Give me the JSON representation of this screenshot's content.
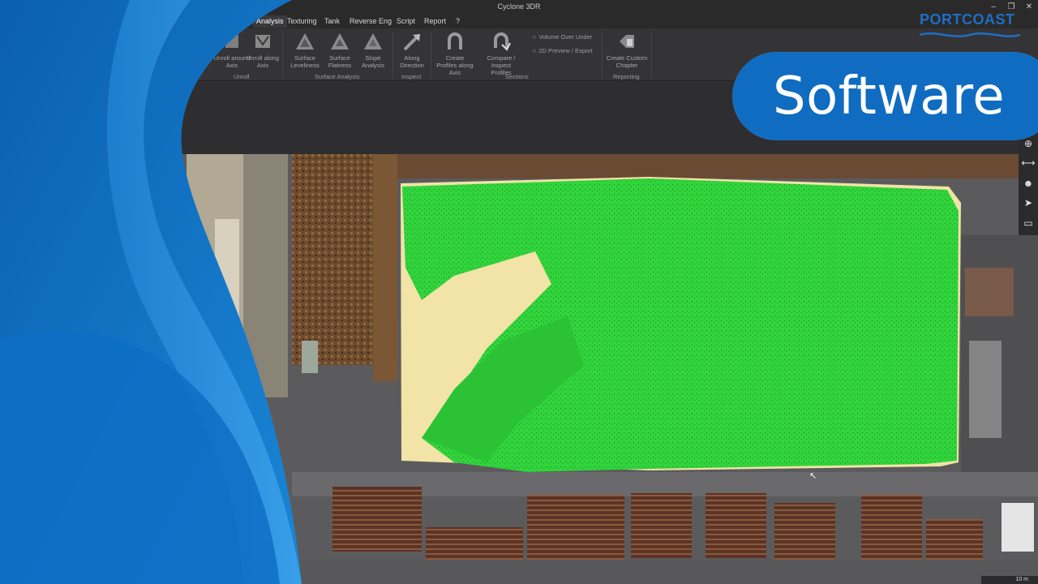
{
  "app": {
    "title": "Cyclone 3DR",
    "window_controls": [
      "–",
      "❐",
      "✕"
    ]
  },
  "menu": {
    "items": [
      {
        "label": "Analysis",
        "active": true
      },
      {
        "label": "Texturing"
      },
      {
        "label": "Tank"
      },
      {
        "label": "Reverse Eng"
      },
      {
        "label": "Script"
      },
      {
        "label": "Report"
      },
      {
        "label": "?"
      }
    ]
  },
  "ribbon": {
    "buttons": [
      {
        "label": "Unroll around Axis"
      },
      {
        "label": "Unroll along Axis"
      },
      {
        "label": "Surface Leveliness"
      },
      {
        "label": "Surface Flatness"
      },
      {
        "label": "Slope Analysis"
      },
      {
        "label": "Along Direction"
      },
      {
        "label": "Create Profiles along Axis"
      },
      {
        "label": "Compare / Inspect Profiles"
      },
      {
        "label": "Create Custom Chapter"
      }
    ],
    "small_buttons": [
      {
        "label": "Volume Over Under"
      },
      {
        "label": "2D Preview / Export"
      }
    ],
    "groups": [
      "Unroll",
      "Surface Analysis",
      "Inspect",
      "Sections",
      "Reporting"
    ]
  },
  "overlay": {
    "brand": "PORTCOAST",
    "headline": "Software"
  },
  "colors": {
    "accent_blue": "#0f6cc0",
    "mesh_green": "#30d43a",
    "sand": "#f2e3a6"
  },
  "status": {
    "zoom": "10 m"
  },
  "toolbar_icons": [
    "pointer-icon",
    "globe-icon",
    "measure-icon",
    "person-icon",
    "send-icon",
    "save-icon"
  ]
}
